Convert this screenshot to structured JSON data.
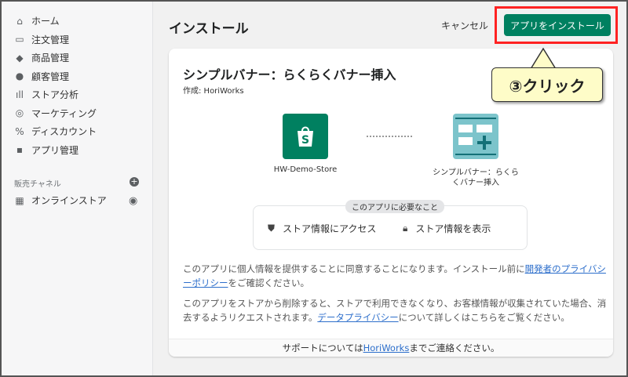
{
  "sidebar": {
    "items": [
      {
        "label": "ホーム",
        "icon": "home-icon",
        "glyph": "⌂"
      },
      {
        "label": "注文管理",
        "icon": "inbox-icon",
        "glyph": "▭"
      },
      {
        "label": "商品管理",
        "icon": "tag-icon",
        "glyph": "◆"
      },
      {
        "label": "顧客管理",
        "icon": "person-icon",
        "glyph": "●"
      },
      {
        "label": "ストア分析",
        "icon": "bar-chart-icon",
        "glyph": "ıll"
      },
      {
        "label": "マーケティング",
        "icon": "target-icon",
        "glyph": "◎"
      },
      {
        "label": "ディスカウント",
        "icon": "discount-icon",
        "glyph": "%"
      },
      {
        "label": "アプリ管理",
        "icon": "apps-icon",
        "glyph": "▪"
      }
    ],
    "section": "販売チャネル",
    "channel": "オンラインストア"
  },
  "header": {
    "title": "インストール",
    "cancel": "キャンセル",
    "install": "アプリをインストール"
  },
  "card": {
    "title": "シンプルバナー：らくらくバナー挿入",
    "by": "作成: HoriWorks",
    "store": "HW-Demo-Store",
    "app_line1": "シンプルバナー：らくら",
    "app_line2": "くバナー挿入",
    "req_title": "このアプリに必要なこと",
    "perm1": "ストア情報にアクセス",
    "perm2": "ストア情報を表示",
    "p1a": "このアプリに個人情報を提供することに同意することになります。インストール前に",
    "p1link": "開発者のプライバシーポリシー",
    "p1b": "をご確認ください。",
    "p2a": "このアプリをストアから削除すると、ストアで利用できなくなり、お客様情報が収集されていた場合、消去するようリクエストされます。",
    "p2link": "データプライバシー",
    "p2b": "について詳しくはこちらをご覧ください。",
    "foot_a": "サポートについては",
    "foot_link": "HoriWorks",
    "foot_b": "までご連絡ください。"
  },
  "callout": "③クリック",
  "colors": {
    "accent": "#008060",
    "highlight": "#ff2222",
    "callout": "#fefcc8"
  }
}
